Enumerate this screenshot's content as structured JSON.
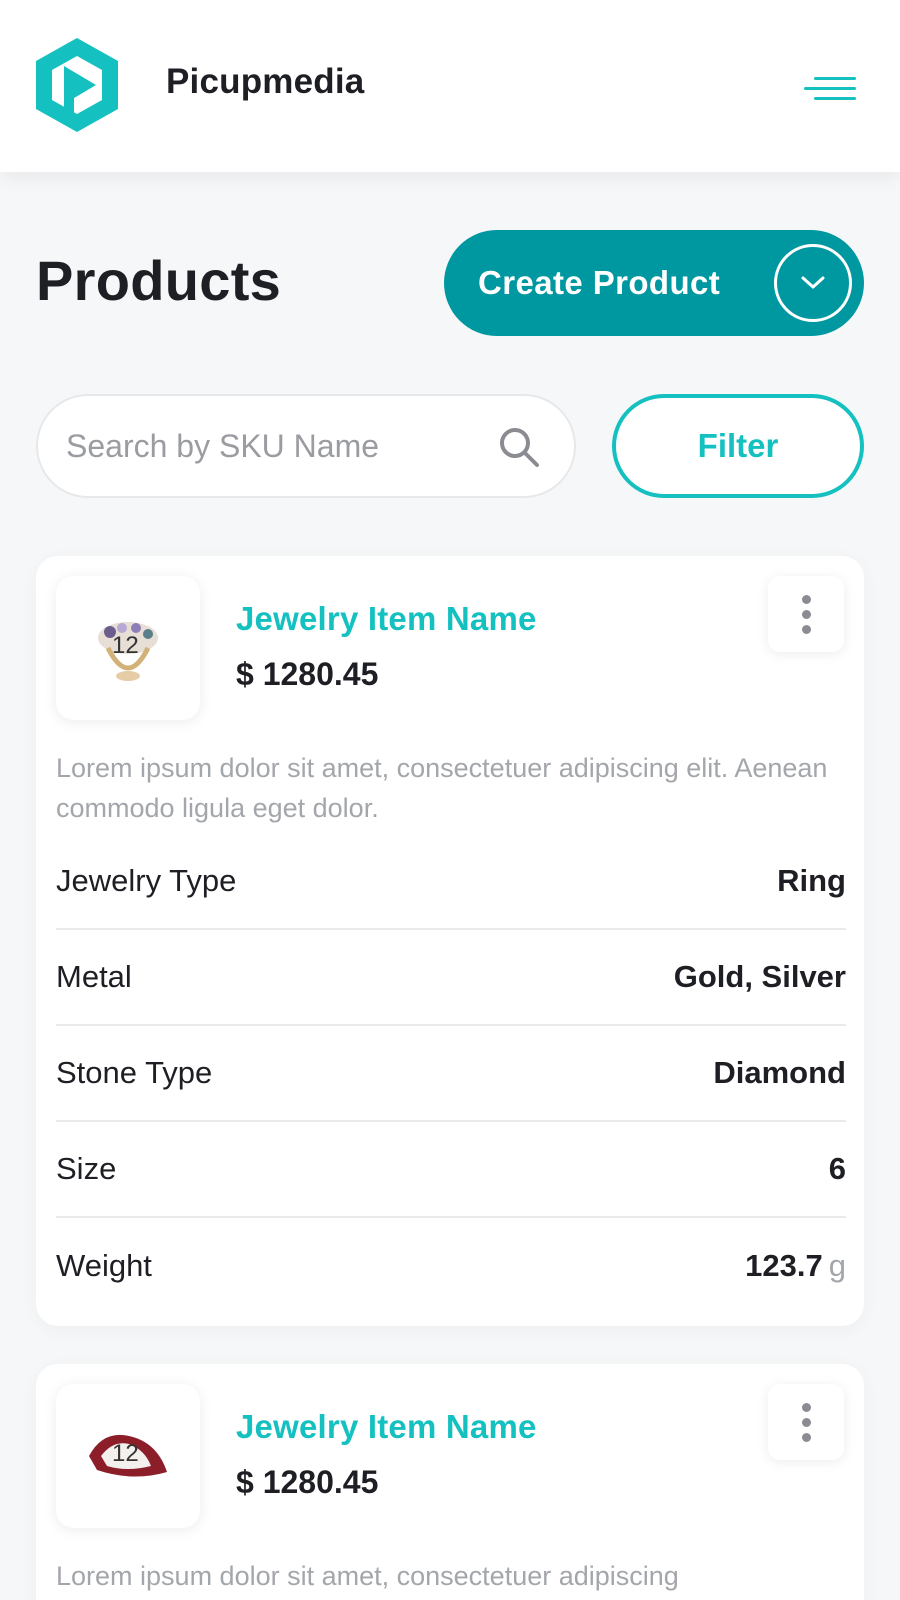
{
  "header": {
    "brand": "Picupmedia",
    "logo_icon": "play-hexagon-logo",
    "menu_icon": "hamburger-menu-icon",
    "accent_color": "#14c0c0"
  },
  "page": {
    "title": "Products",
    "create_button": "Create Product",
    "create_button_color": "#0098a0"
  },
  "search": {
    "placeholder": "Search by SKU Name",
    "value": ""
  },
  "filter": {
    "label": "Filter"
  },
  "products": [
    {
      "quantity": "12",
      "name": "Jewelry Item Name",
      "price": "$ 1280.45",
      "description": "Lorem ipsum dolor sit amet, consectetuer adipiscing elit. Aenean commodo ligula eget dolor.",
      "attributes": [
        {
          "label": "Jewelry Type",
          "value": "Ring"
        },
        {
          "label": "Metal",
          "value": "Gold, Silver"
        },
        {
          "label": "Stone Type",
          "value": "Diamond"
        },
        {
          "label": "Size",
          "value": "6"
        },
        {
          "label": "Weight",
          "value": "123.7",
          "unit": "g"
        }
      ]
    },
    {
      "quantity": "12",
      "name": "Jewelry Item Name",
      "price": "$ 1280.45",
      "description": "Lorem ipsum dolor sit amet, consectetuer adipiscing"
    }
  ]
}
